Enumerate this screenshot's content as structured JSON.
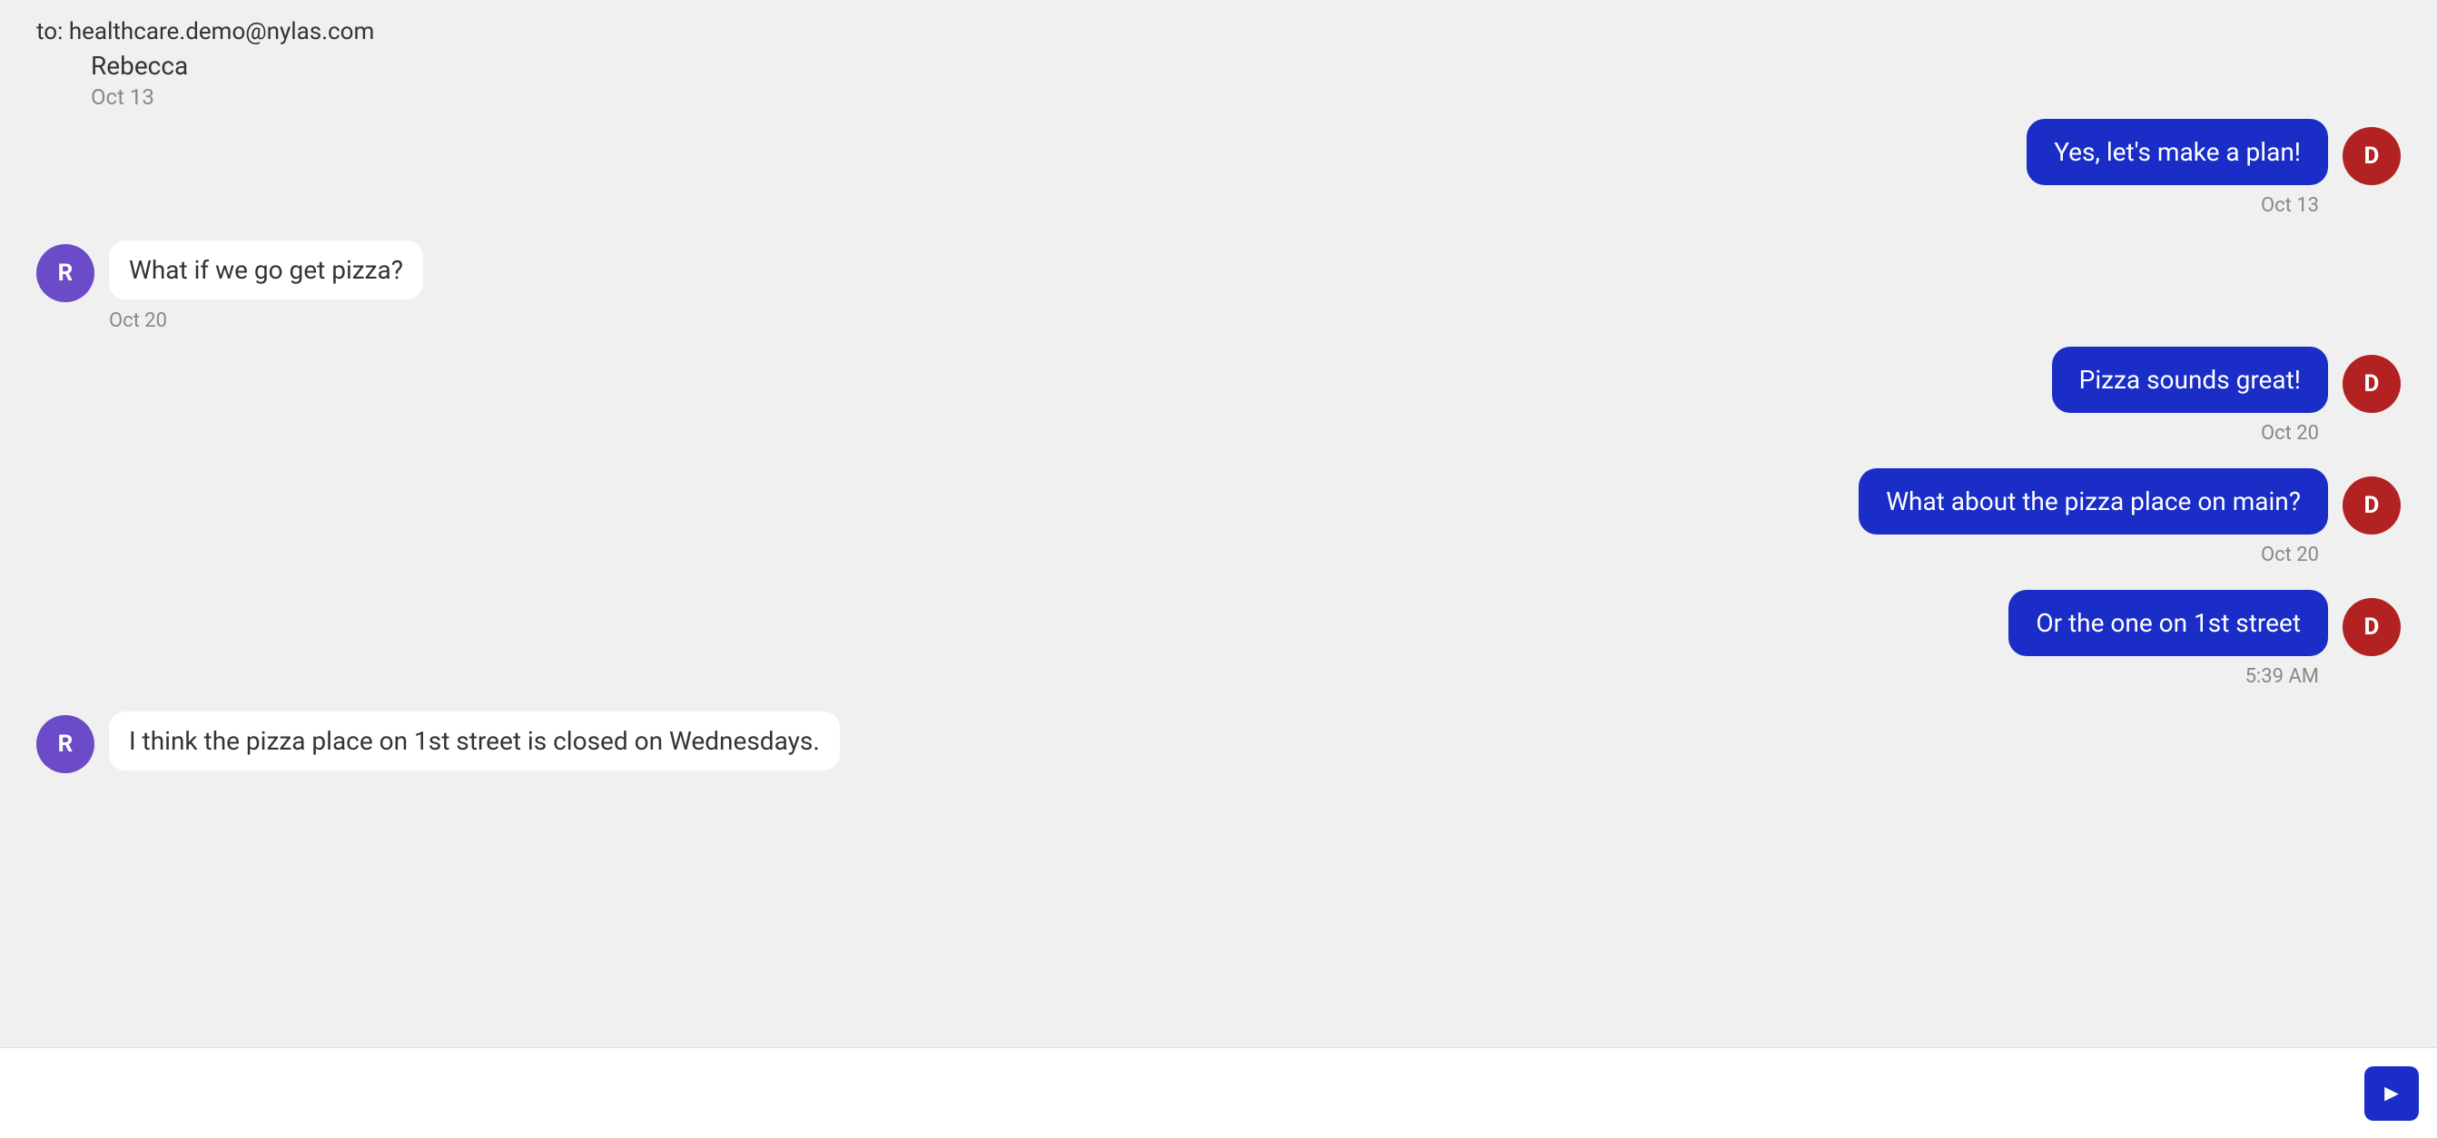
{
  "header": {
    "to_label": "to: healthcare.demo@nylas.com",
    "sender_name": "Rebecca",
    "date_oct13": "Oct 13"
  },
  "messages": [
    {
      "id": "msg1",
      "type": "sent",
      "text": "Yes, let's make a plan!",
      "timestamp": "Oct 13",
      "avatar": "D",
      "avatar_color": "#b22222"
    },
    {
      "id": "msg2",
      "type": "received",
      "text": "What if we go get pizza?",
      "timestamp": "Oct 20",
      "avatar": "R",
      "avatar_color": "#6b4bc8"
    },
    {
      "id": "msg3",
      "type": "sent",
      "text": "Pizza sounds great!",
      "timestamp": "Oct 20",
      "avatar": "D",
      "avatar_color": "#b22222"
    },
    {
      "id": "msg4",
      "type": "sent",
      "text": "What about the pizza place on main?",
      "timestamp": "Oct 20",
      "avatar": "D",
      "avatar_color": "#b22222"
    },
    {
      "id": "msg5",
      "type": "sent",
      "text": "Or the one on 1st street",
      "timestamp": "5:39 AM",
      "avatar": "D",
      "avatar_color": "#b22222"
    },
    {
      "id": "msg6",
      "type": "received",
      "text": "I think the pizza place on 1st street is closed on Wednesdays.",
      "timestamp": "",
      "avatar": "R",
      "avatar_color": "#6b4bc8"
    }
  ],
  "input": {
    "placeholder": "",
    "send_button_label": "Send"
  }
}
